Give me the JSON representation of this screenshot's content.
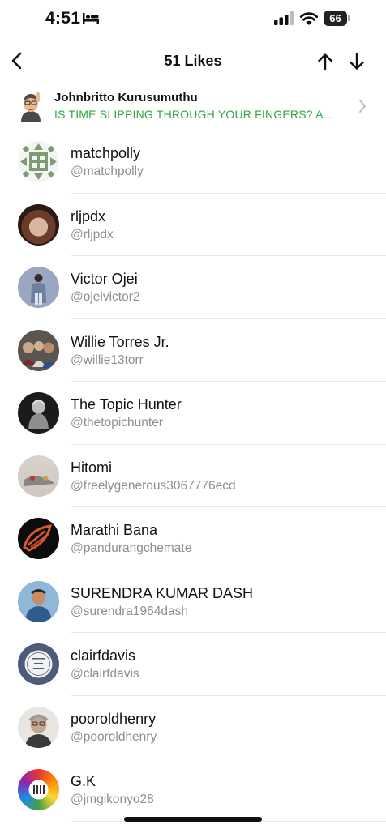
{
  "status_bar": {
    "time": "4:51",
    "battery": "66"
  },
  "nav": {
    "title": "51 Likes"
  },
  "post": {
    "author": "Johnbritto Kurusumuthu",
    "text": "IS TIME SLIPPING THROUGH YOUR FINGERS? A..."
  },
  "likers": [
    {
      "name": "matchpolly",
      "handle": "@matchpolly"
    },
    {
      "name": "rljpdx",
      "handle": "@rljpdx"
    },
    {
      "name": "Victor Ojei",
      "handle": "@ojeivictor2"
    },
    {
      "name": "Willie Torres Jr.",
      "handle": "@willie13torr"
    },
    {
      "name": "The Topic Hunter",
      "handle": "@thetopichunter"
    },
    {
      "name": "Hitomi",
      "handle": "@freelygenerous3067776ecd"
    },
    {
      "name": "Marathi Bana",
      "handle": "@pandurangchemate"
    },
    {
      "name": "SURENDRA KUMAR DASH",
      "handle": "@surendra1964dash"
    },
    {
      "name": "clairfdavis",
      "handle": "@clairfdavis"
    },
    {
      "name": "pooroldhenry",
      "handle": "@pooroldhenry"
    },
    {
      "name": "G.K",
      "handle": "@jmgikonyo28"
    }
  ],
  "icons": {
    "back": "chevron-left-icon",
    "up": "arrow-up-icon",
    "down": "arrow-down-icon",
    "post_open": "chevron-right-icon"
  },
  "colors": {
    "accent_green": "#2fa843",
    "handle_gray": "#8e8e8e"
  }
}
